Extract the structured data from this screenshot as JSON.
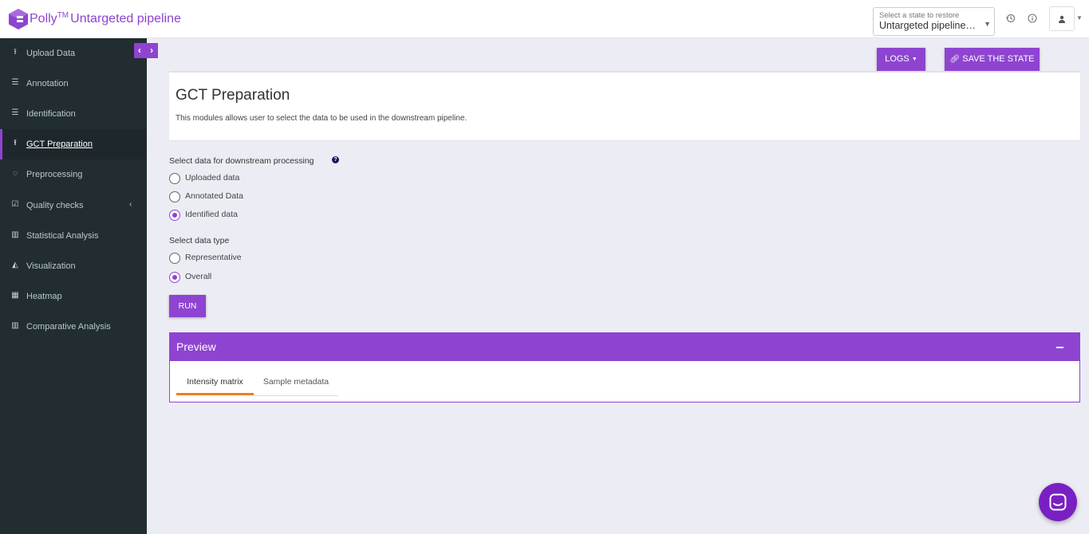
{
  "header": {
    "brand_name": "Polly",
    "brand_tm": "TM",
    "brand_product": "Untargeted pipeline",
    "state_select_label": "Select a state to restore",
    "state_select_value": "Untargeted pipeline F...",
    "icons": [
      "history-icon",
      "info-icon",
      "user-icon"
    ]
  },
  "sidebar": {
    "collapse_label": "‹ ›",
    "items": [
      {
        "label": "Upload Data",
        "icon": "upload-icon",
        "active": false
      },
      {
        "label": "Annotation",
        "icon": "list-icon",
        "active": false
      },
      {
        "label": "Identification",
        "icon": "list-icon",
        "active": false
      },
      {
        "label": "GCT Preparation",
        "icon": "upload-icon",
        "active": true
      },
      {
        "label": "Preprocessing",
        "icon": "spinner-icon",
        "active": false
      },
      {
        "label": "Quality checks",
        "icon": "checkbox-icon",
        "active": false,
        "has_submenu": true
      },
      {
        "label": "Statistical Analysis",
        "icon": "bar-chart-icon",
        "active": false
      },
      {
        "label": "Visualization",
        "icon": "area-chart-icon",
        "active": false
      },
      {
        "label": "Heatmap",
        "icon": "grid-icon",
        "active": false
      },
      {
        "label": "Comparative Analysis",
        "icon": "bar-chart-icon",
        "active": false
      }
    ]
  },
  "toolbar": {
    "logs_label": "LOGS",
    "save_label": "SAVE THE STATE"
  },
  "module": {
    "title": "GCT Preparation",
    "description": "This modules allows user to select the data to be used in the downstream pipeline."
  },
  "form": {
    "data_select_label": "Select data for downstream processing",
    "data_options": [
      "Uploaded data",
      "Annotated Data",
      "Identified data"
    ],
    "data_selected": "Identified data",
    "type_select_label": "Select data type",
    "type_options": [
      "Representative",
      "Overall"
    ],
    "type_selected": "Overall",
    "run_label": "RUN"
  },
  "preview": {
    "title": "Preview",
    "tabs": [
      "Intensity matrix",
      "Sample metadata"
    ],
    "active_tab": "Intensity matrix"
  },
  "colors": {
    "accent": "#8e44d1",
    "sidebar_bg": "#222d32",
    "tab_underline": "#f07c1d",
    "chat_button": "#7a1fc4"
  }
}
